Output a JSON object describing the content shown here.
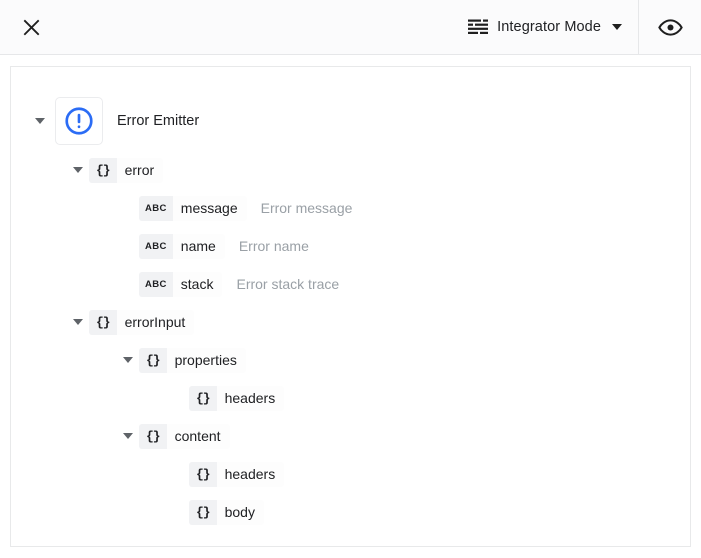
{
  "toolbar": {
    "close_icon": "close-icon",
    "mode_icon": "list-lines-icon",
    "mode_label": "Integrator Mode",
    "mode_caret": "chevron-down-icon",
    "eye_icon": "eye-icon"
  },
  "tree": {
    "root": {
      "icon": "error-circle-icon",
      "label": "Error Emitter",
      "expanded": true
    },
    "nodes": [
      {
        "indent": 1,
        "twisty": "expanded",
        "badge": "{}",
        "badge_type": "brace",
        "name": "error",
        "desc": ""
      },
      {
        "indent": 2,
        "twisty": "none",
        "badge": "ABC",
        "badge_type": "abc",
        "name": "message",
        "desc": "Error message"
      },
      {
        "indent": 2,
        "twisty": "none",
        "badge": "ABC",
        "badge_type": "abc",
        "name": "name",
        "desc": "Error name"
      },
      {
        "indent": 2,
        "twisty": "none",
        "badge": "ABC",
        "badge_type": "abc",
        "name": "stack",
        "desc": "Error stack trace"
      },
      {
        "indent": 1,
        "twisty": "expanded",
        "badge": "{}",
        "badge_type": "brace",
        "name": "errorInput",
        "desc": ""
      },
      {
        "indent": 2,
        "twisty": "expanded",
        "badge": "{}",
        "badge_type": "brace",
        "name": "properties",
        "desc": ""
      },
      {
        "indent": 3,
        "twisty": "none",
        "badge": "{}",
        "badge_type": "brace",
        "name": "headers",
        "desc": ""
      },
      {
        "indent": 2,
        "twisty": "expanded",
        "badge": "{}",
        "badge_type": "brace",
        "name": "content",
        "desc": ""
      },
      {
        "indent": 3,
        "twisty": "none",
        "badge": "{}",
        "badge_type": "brace",
        "name": "headers",
        "desc": ""
      },
      {
        "indent": 3,
        "twisty": "none",
        "badge": "{}",
        "badge_type": "brace",
        "name": "body",
        "desc": ""
      }
    ]
  },
  "colors": {
    "accent_blue": "#2b6cf5",
    "toolbar_bg": "#fbfbfc",
    "border": "#e6e7e9",
    "text": "#202124",
    "muted": "#9aa0a6"
  }
}
